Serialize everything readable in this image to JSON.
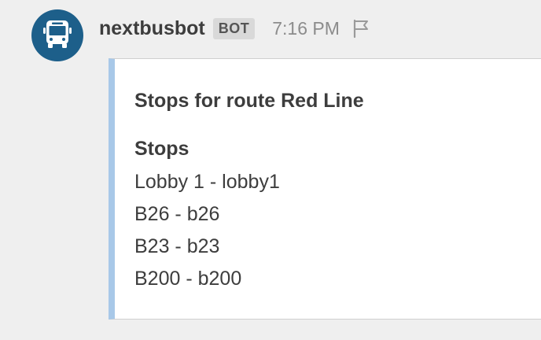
{
  "message": {
    "avatar_icon": "bus-icon",
    "avatar_color": "#1d5f8a",
    "username": "nextbusbot",
    "badge": "BOT",
    "timestamp": "7:16 PM",
    "flag_icon": "flag-icon"
  },
  "attachment": {
    "accent_color": "#a8c8e8",
    "title": "Stops for route Red Line",
    "section_title": "Stops",
    "stops": [
      "Lobby 1 - lobby1",
      "B26 - b26",
      "B23 - b23",
      "B200 - b200"
    ]
  }
}
